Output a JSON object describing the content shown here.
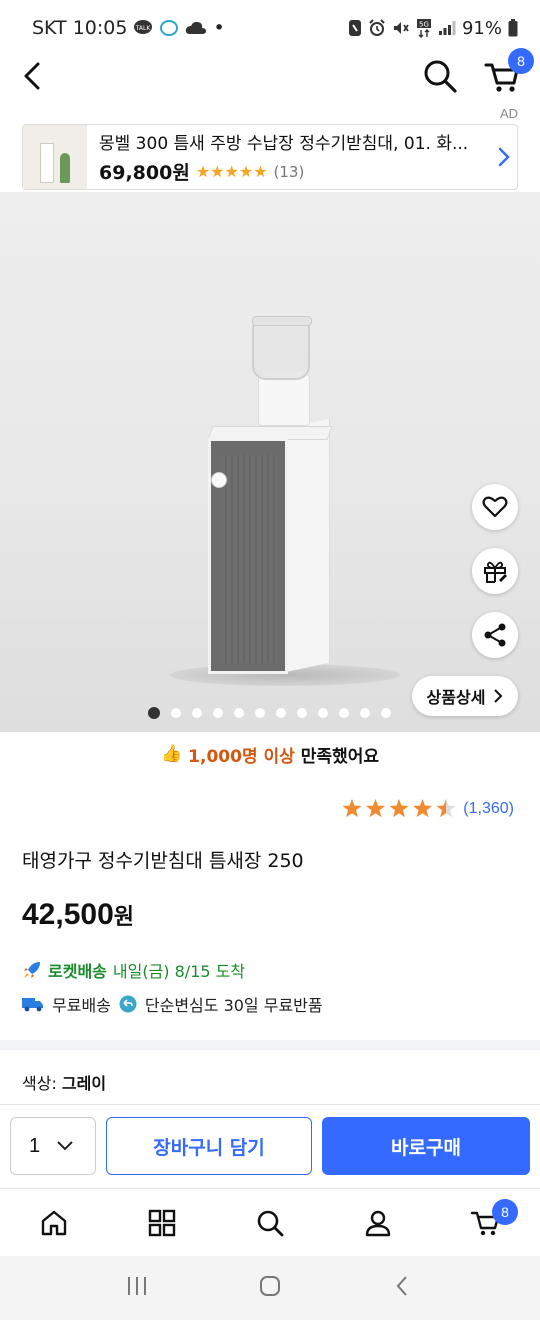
{
  "status_bar": {
    "carrier_time": "SKT 10:05",
    "battery": "91%",
    "dot": "•"
  },
  "header": {
    "cart_count": "8"
  },
  "ad": {
    "label": "AD",
    "title": "몽벨 300 틈새 주방 수납장 정수기받침대, 01. 화...",
    "price": "69,800원",
    "stars": "★★★★★",
    "review_count": "(13)"
  },
  "hero": {
    "detail_label": "상품상세",
    "slide_count": 12,
    "active_slide": 1
  },
  "satisfaction": {
    "emoji": "👍",
    "highlight": "1,000명 이상",
    "text": "만족했어요"
  },
  "rating": {
    "stars": "★★★★★",
    "value": 4.5,
    "count": "(1,360)"
  },
  "product": {
    "title": "태영가구 정수기받침대 틈새장 250",
    "price_number": "42,500",
    "price_unit": "원",
    "rocket_label": "로켓배송",
    "delivery_text": "내일(금) 8/15 도착",
    "free_shipping": "무료배송",
    "free_return": "단순변심도 30일 무료반품",
    "color_label": "색상: ",
    "color_value": "그레이"
  },
  "buy_bar": {
    "quantity": "1",
    "add_to_cart": "장바구니 담기",
    "buy_now": "바로구매"
  },
  "tab_bar": {
    "cart_count": "8"
  },
  "colors": {
    "accent": "#346aff",
    "rocket_green": "#1a8c2b",
    "highlight_orange": "#d4560f",
    "star_orange": "#f28a2f"
  }
}
